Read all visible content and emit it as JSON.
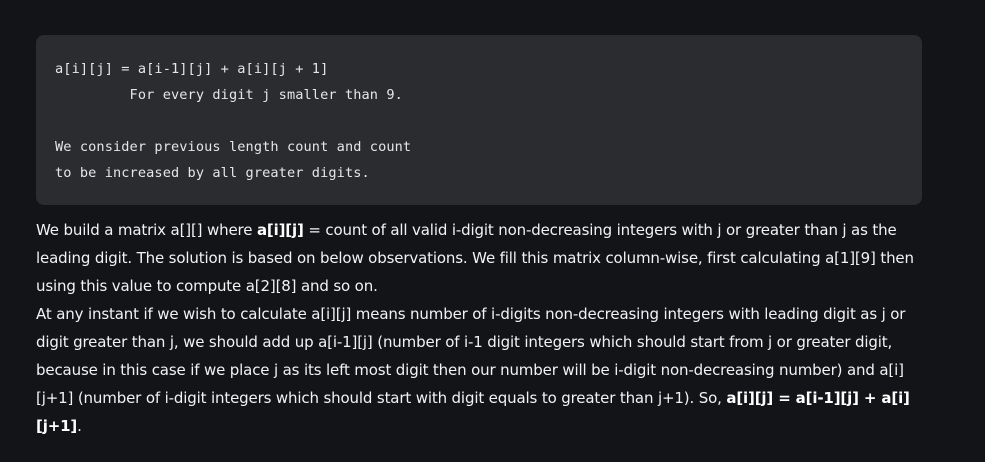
{
  "code": {
    "lines": [
      "a[i][j] = a[i-1][j] + a[i][j + 1]",
      "         For every digit j smaller than 9.",
      "",
      "We consider previous length count and count",
      "to be increased by all greater digits."
    ]
  },
  "paragraph1": {
    "t1": "We build a matrix a[][] where ",
    "b1": "a[i][j]",
    "t2": " = count of all valid i-digit non-decreasing integers with j or greater than j as the leading digit. The solution is based on below observations. We fill this matrix column-wise, first calculating a[1][9] then using this value to compute a[2][8] and so on."
  },
  "paragraph2": {
    "t1": "At any instant if we wish to calculate a[i][j] means number of i-digits non-decreasing integers with leading digit as j or digit greater than j, we should add up a[i-1][j] (number of i-1 digit integers which should start from j or greater digit, because in this case if we place j as its left most digit then our number will be i-digit non-decreasing number) and a[i][j+1] (number of i-digit integers which should start with digit equals to greater than j+1). So, ",
    "b1": "a[i][j] = a[i-1][j] + a[i][j+1]",
    "t2": "."
  }
}
